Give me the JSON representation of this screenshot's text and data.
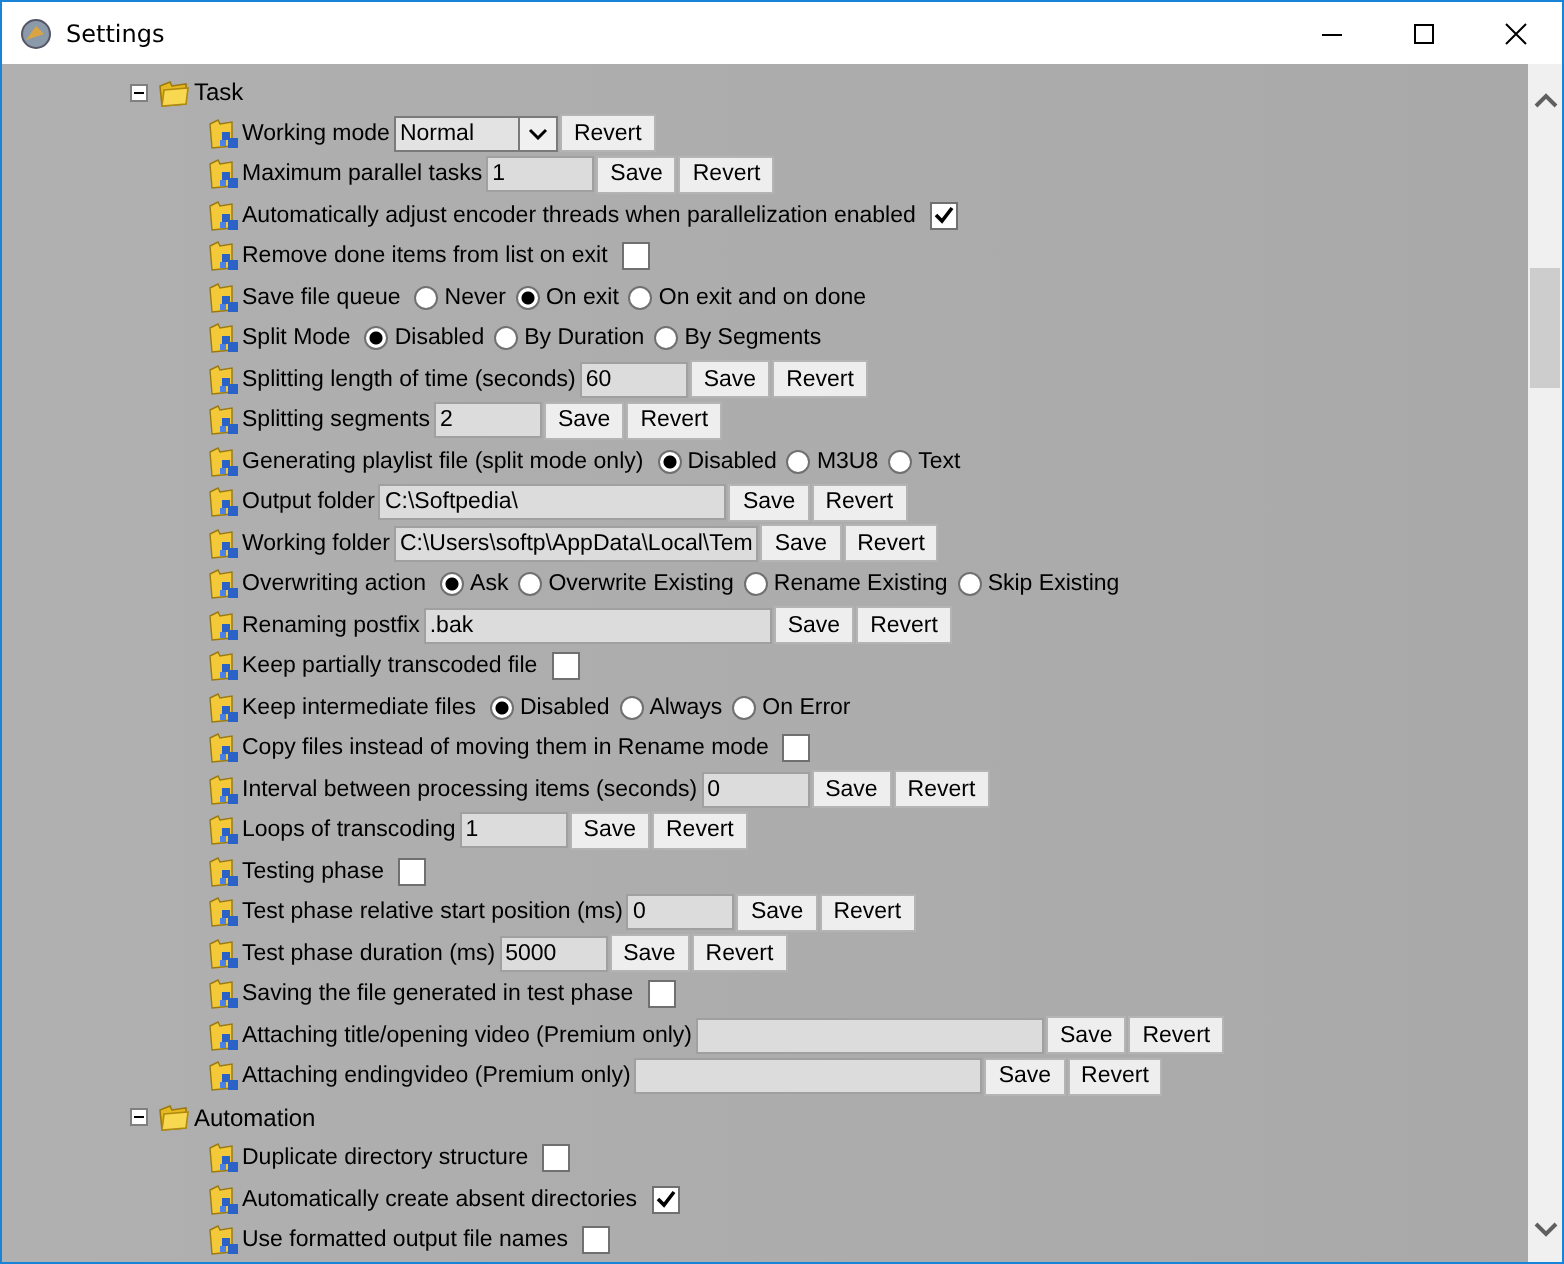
{
  "window": {
    "title": "Settings"
  },
  "tree": [
    {
      "label": "Task",
      "expanded": true,
      "children": [
        {
          "kind": "select",
          "label": "Working mode",
          "value": "Normal",
          "buttons": [
            "Revert"
          ]
        },
        {
          "kind": "text",
          "label": "Maximum parallel tasks",
          "value": "1",
          "buttons": [
            "Save",
            "Revert"
          ]
        },
        {
          "kind": "check",
          "label": "Automatically adjust encoder threads when parallelization enabled",
          "checked": true
        },
        {
          "kind": "check",
          "label": "Remove done items from list on exit",
          "checked": false
        },
        {
          "kind": "radio",
          "label": "Save file queue",
          "options": [
            {
              "label": "Never",
              "selected": false
            },
            {
              "label": "On exit",
              "selected": true
            },
            {
              "label": "On exit and on done",
              "selected": false
            }
          ]
        },
        {
          "kind": "radio",
          "label": "Split Mode",
          "options": [
            {
              "label": "Disabled",
              "selected": true
            },
            {
              "label": "By Duration",
              "selected": false
            },
            {
              "label": "By Segments",
              "selected": false
            }
          ]
        },
        {
          "kind": "text",
          "label": "Splitting length of time (seconds)",
          "value": "60",
          "buttons": [
            "Save",
            "Revert"
          ]
        },
        {
          "kind": "text",
          "label": "Splitting segments",
          "value": "2",
          "buttons": [
            "Save",
            "Revert"
          ]
        },
        {
          "kind": "radio",
          "label": "Generating playlist file (split mode only)",
          "options": [
            {
              "label": "Disabled",
              "selected": true
            },
            {
              "label": "M3U8",
              "selected": false
            },
            {
              "label": "Text",
              "selected": false
            }
          ]
        },
        {
          "kind": "longtext",
          "label": "Output folder",
          "value": "C:\\Softpedia\\",
          "buttons": [
            "Save",
            "Revert"
          ]
        },
        {
          "kind": "longtext",
          "label": "Working folder",
          "value": "C:\\Users\\softp\\AppData\\Local\\Tem",
          "buttons": [
            "Save",
            "Revert"
          ]
        },
        {
          "kind": "radio",
          "label": "Overwriting action",
          "options": [
            {
              "label": "Ask",
              "selected": true
            },
            {
              "label": "Overwrite Existing",
              "selected": false
            },
            {
              "label": "Rename Existing",
              "selected": false
            },
            {
              "label": "Skip Existing",
              "selected": false
            }
          ]
        },
        {
          "kind": "longtext",
          "label": "Renaming postfix",
          "value": ".bak",
          "buttons": [
            "Save",
            "Revert"
          ]
        },
        {
          "kind": "check",
          "label": "Keep partially transcoded file",
          "checked": false
        },
        {
          "kind": "radio",
          "label": "Keep intermediate files",
          "options": [
            {
              "label": "Disabled",
              "selected": true
            },
            {
              "label": "Always",
              "selected": false
            },
            {
              "label": "On Error",
              "selected": false
            }
          ]
        },
        {
          "kind": "check",
          "label": "Copy files instead of moving them in Rename mode",
          "checked": false
        },
        {
          "kind": "text",
          "label": "Interval between processing items (seconds)",
          "value": "0",
          "buttons": [
            "Save",
            "Revert"
          ]
        },
        {
          "kind": "text",
          "label": "Loops of transcoding",
          "value": "1",
          "buttons": [
            "Save",
            "Revert"
          ]
        },
        {
          "kind": "check",
          "label": "Testing phase",
          "checked": false
        },
        {
          "kind": "text",
          "label": "Test phase relative start position (ms)",
          "value": "0",
          "buttons": [
            "Save",
            "Revert"
          ]
        },
        {
          "kind": "text",
          "label": "Test phase duration (ms)",
          "value": "5000",
          "buttons": [
            "Save",
            "Revert"
          ]
        },
        {
          "kind": "check",
          "label": "Saving the file generated in test phase",
          "checked": false
        },
        {
          "kind": "longtext",
          "label": "Attaching title/opening video (Premium only)",
          "buttons": [
            "Save",
            "Revert"
          ]
        },
        {
          "kind": "longtext",
          "label": "Attaching endingvideo (Premium only)",
          "buttons": [
            "Save",
            "Revert"
          ]
        }
      ]
    },
    {
      "label": "Automation",
      "expanded": true,
      "children": [
        {
          "kind": "check",
          "label": "Duplicate directory structure",
          "checked": false
        },
        {
          "kind": "check",
          "label": "Automatically create absent directories",
          "checked": true
        },
        {
          "kind": "check",
          "label": "Use formatted output file names",
          "checked": false
        }
      ]
    }
  ]
}
